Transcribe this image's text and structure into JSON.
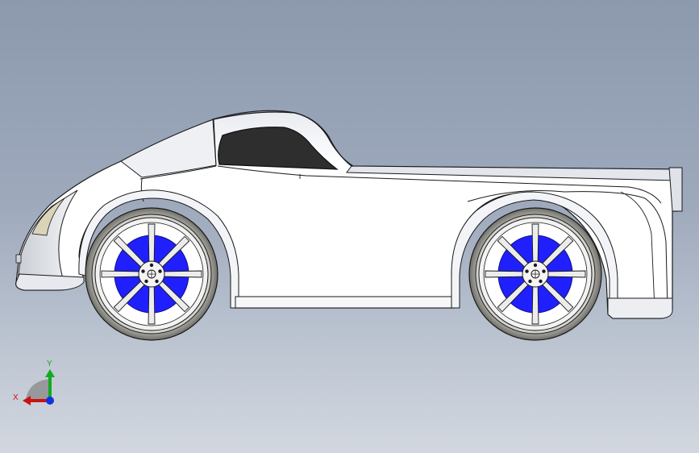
{
  "viewport": {
    "background_top": "#8c99ad",
    "background_bottom": "#d2d7df"
  },
  "model": {
    "body_color": "#ffffff",
    "outline_color": "#1a1a1a",
    "window_color": "#2e2e2e",
    "rim_color": "#2020ff",
    "tire_color": "#8a8a86"
  },
  "triad": {
    "x_label": "X",
    "y_label": "Y",
    "x_color": "#cc1111",
    "y_color": "#11aa22",
    "z_color": "#1133dd"
  }
}
